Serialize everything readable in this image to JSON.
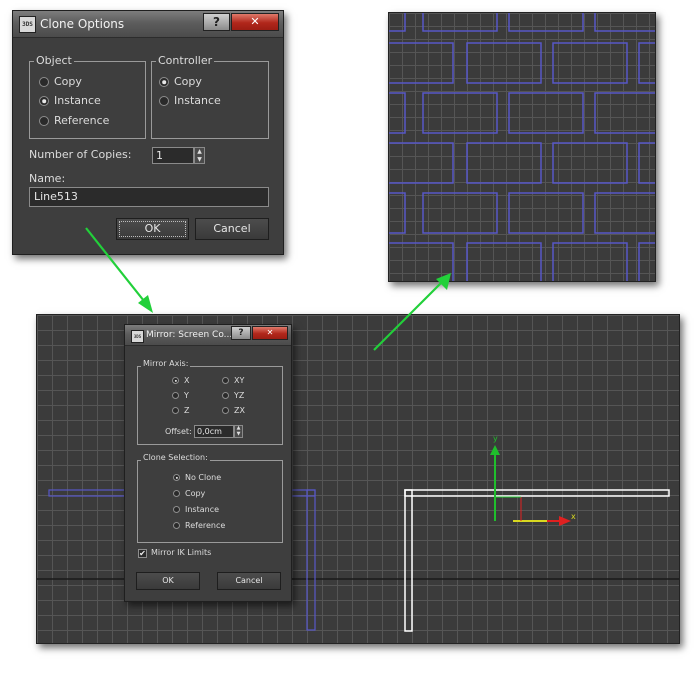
{
  "clone_options": {
    "app_icon": "3DS",
    "title": "Clone Options",
    "help_label": "?",
    "close_label": "✕",
    "object_group": {
      "label": "Object",
      "options": [
        {
          "label": "Copy",
          "selected": false
        },
        {
          "label": "Instance",
          "selected": true
        },
        {
          "label": "Reference",
          "selected": false
        }
      ]
    },
    "controller_group": {
      "label": "Controller",
      "options": [
        {
          "label": "Copy",
          "selected": true
        },
        {
          "label": "Instance",
          "selected": false
        }
      ]
    },
    "copies_label": "Number of Copies:",
    "copies_value": "1",
    "name_label": "Name:",
    "name_value": "Line513",
    "ok_label": "OK",
    "cancel_label": "Cancel"
  },
  "mirror_dialog": {
    "app_icon": "3DS",
    "title": "Mirror: Screen Co...",
    "help_label": "?",
    "close_label": "✕",
    "axis_group_label": "Mirror Axis:",
    "axes": [
      {
        "label": "X",
        "selected": true
      },
      {
        "label": "Y",
        "selected": false
      },
      {
        "label": "Z",
        "selected": false
      },
      {
        "label": "XY",
        "selected": false
      },
      {
        "label": "YZ",
        "selected": false
      },
      {
        "label": "ZX",
        "selected": false
      }
    ],
    "offset_label": "Offset:",
    "offset_value": "0,0cm",
    "clone_group_label": "Clone Selection:",
    "clone_options": [
      {
        "label": "No Clone",
        "selected": true
      },
      {
        "label": "Copy",
        "selected": false
      },
      {
        "label": "Instance",
        "selected": false
      },
      {
        "label": "Reference",
        "selected": false
      }
    ],
    "mirror_ik_label": "Mirror IK Limits",
    "mirror_ik_checked": true,
    "ok_label": "OK",
    "cancel_label": "Cancel"
  },
  "viewport_main": {
    "gizmo_y_label": "y",
    "gizmo_x_label": "x"
  },
  "colors": {
    "arrow": "#22d03a",
    "grid_bg": "#3b3b3b",
    "spline_blue": "#5757c8",
    "spline_white": "#ffffff"
  }
}
